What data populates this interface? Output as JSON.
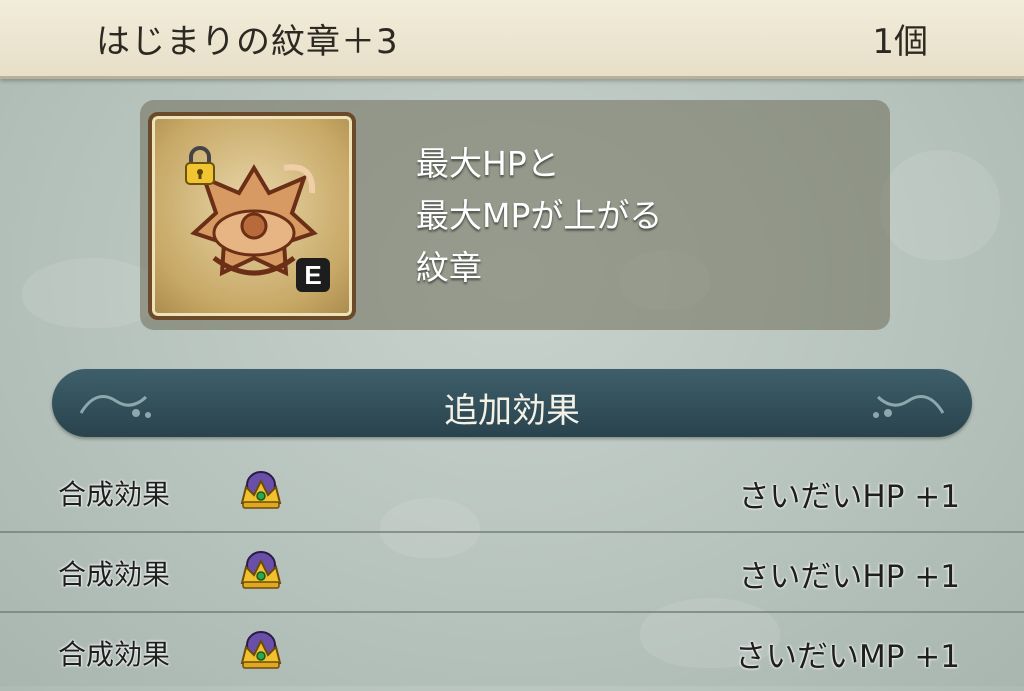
{
  "header": {
    "item_name": "はじまりの紋章＋3",
    "count": "1個"
  },
  "item": {
    "icon": "emblem-icon",
    "locked": true,
    "equipped_badge": "E",
    "description_lines": [
      "最大HPと",
      "最大MPが上がる",
      "紋章"
    ]
  },
  "additional_effects": {
    "title": "追加効果",
    "rows": [
      {
        "label": "合成効果",
        "icon": "crown-icon",
        "value": "さいだいHP  +1"
      },
      {
        "label": "合成効果",
        "icon": "crown-icon",
        "value": "さいだいHP  +1"
      },
      {
        "label": "合成効果",
        "icon": "crown-icon",
        "value": "さいだいMP  +1"
      }
    ]
  },
  "colors": {
    "header_bg": "#ece5d0",
    "effect_bar": "#33505a",
    "panel": "#7a7a60"
  }
}
